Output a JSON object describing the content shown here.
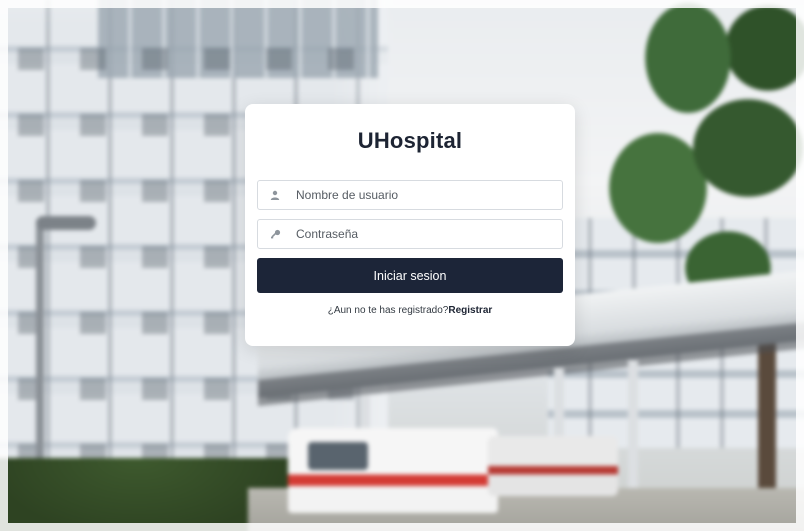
{
  "app": {
    "title": "UHospital"
  },
  "login": {
    "username_placeholder": "Nombre de usuario",
    "username_value": "",
    "username_icon": "user-icon",
    "password_placeholder": "Contraseña",
    "password_value": "",
    "password_icon": "key-icon",
    "submit_label": "Iniciar sesion",
    "register_prompt": "¿Aun no te has registrado?",
    "register_link": "Registrar"
  },
  "colors": {
    "button_bg": "#1c2538",
    "title_text": "#1d2433",
    "card_bg": "#ffffff"
  }
}
